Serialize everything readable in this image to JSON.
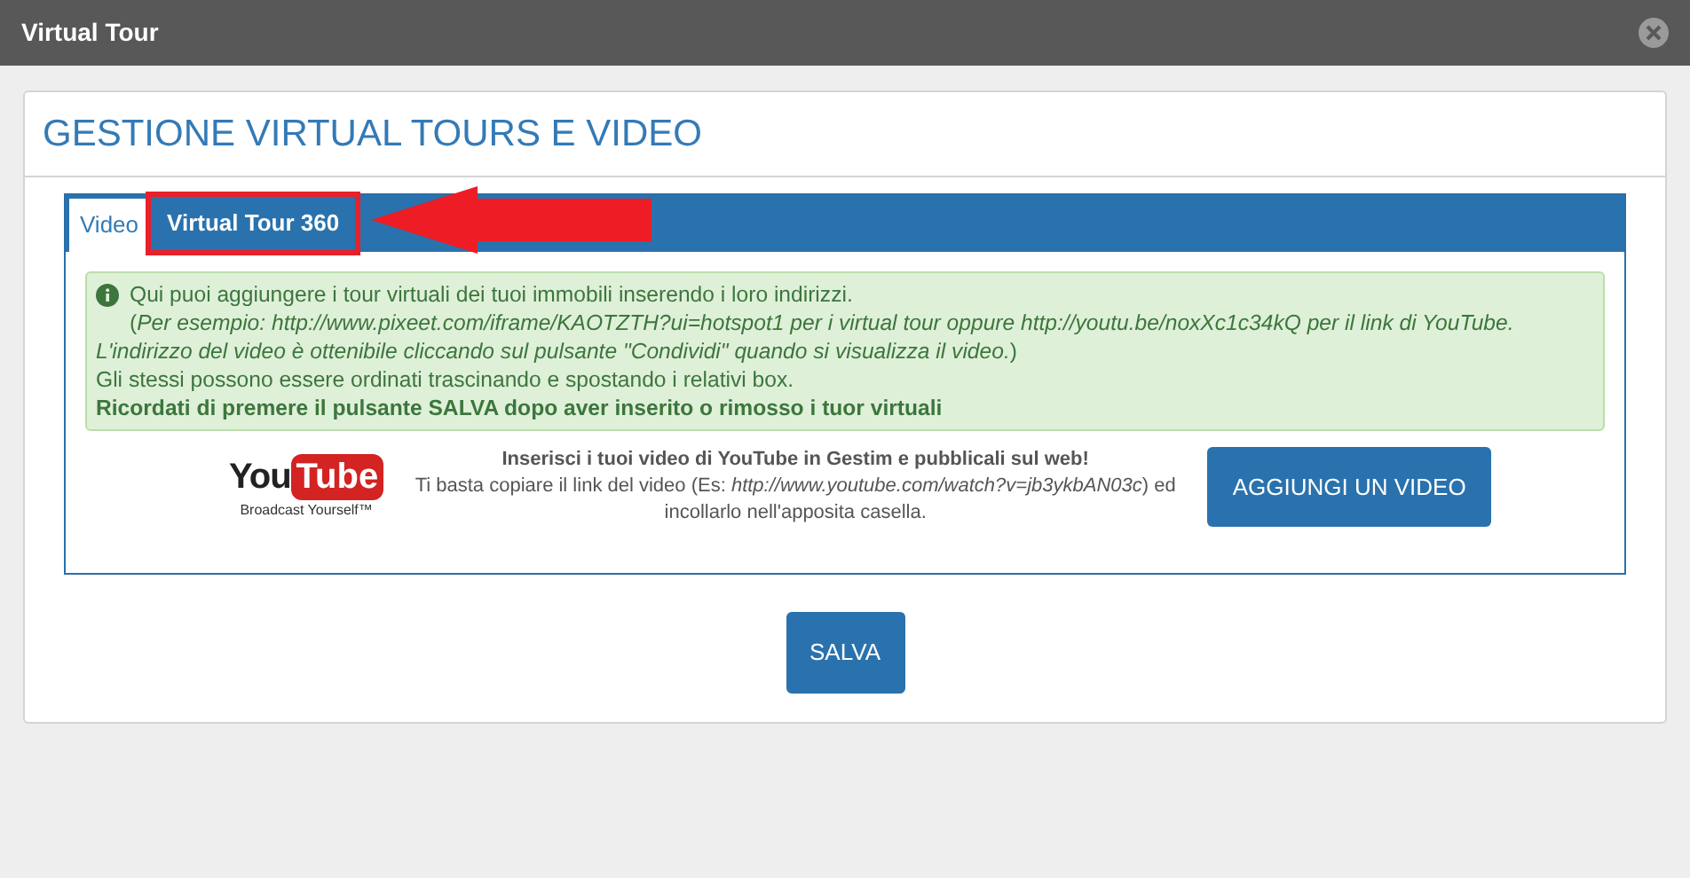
{
  "window": {
    "title": "Virtual Tour"
  },
  "panel": {
    "title": "GESTIONE VIRTUAL TOURS E VIDEO"
  },
  "tabs": [
    {
      "label": "Video",
      "selected": true
    },
    {
      "label": "Virtual Tour 360",
      "selected": false,
      "highlighted": true
    }
  ],
  "info": {
    "lines": [
      "Qui puoi aggiungere i tour virtuali dei tuoi immobili inserendo i loro indirizzi.",
      "(*Per esempio: http://www.pixeet.com/iframe/KAOTZTH?ui=hotspot1 per i virtual tour oppure http://youtu.be/noxXc1c34kQ per il link di YouTube. L'indirizzo del video è ottenibile cliccando sul pulsante \"Condividi\" quando si visualizza il video.*)",
      "Gli stessi possono essere ordinati trascinando e spostando i relativi box."
    ],
    "emphasis": "Ricordati di premere il pulsante SALVA dopo aver inserito o rimosso i tuor virtuali"
  },
  "youtube": {
    "logo": {
      "part1": "You",
      "part2": "Tube",
      "tagline": "Broadcast Yourself™"
    },
    "heading": "Inserisci i tuoi video di YouTube in Gestim e pubblicali sul web!",
    "text": "Ti basta copiare il link del video (Es: *http://www.youtube.com/watch?v=jb3ykbAN03c*) ed incollarlo nell'apposita casella.",
    "button": "AGGIUNGI UN VIDEO"
  },
  "save_button": "SALVA"
}
